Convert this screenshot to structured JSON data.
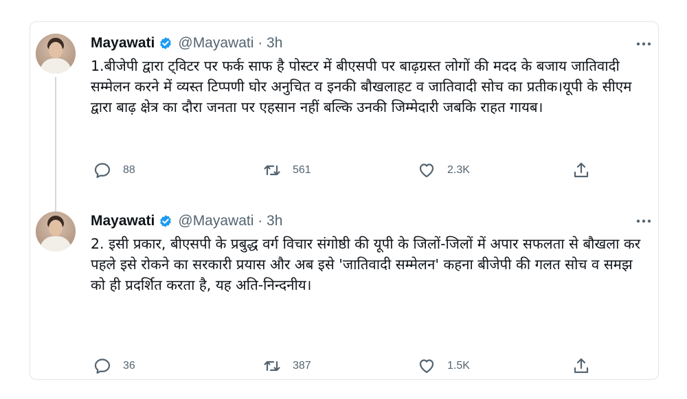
{
  "tweets": [
    {
      "name": "Mayawati",
      "handle": "@Mayawati · 3h",
      "text": "1.बीजेपी द्वारा ट्विटर पर फर्क साफ है पोस्टर में बीएसपी पर बाढ़ग्रस्त लोगों की मदद के बजाय जातिवादी सम्मेलन करने में व्यस्त टिप्पणी घोर अनुचित व इनकी बौखलाहट व जातिवादी सोच का प्रतीक।यूपी के सीएम द्वारा बाढ़ क्षेत्र का दौरा जनता पर एहसान नहीं बल्कि उनकी जिम्मेदारी जबकि राहत गायब।",
      "reply_count": "88",
      "retweet_count": "561",
      "like_count": "2.3K"
    },
    {
      "name": "Mayawati",
      "handle": "@Mayawati · 3h",
      "text": "2. इसी प्रकार, बीएसपी के प्रबुद्ध वर्ग विचार संगोष्ठी की यूपी के जिलों-जिलों में अपार सफलता से बौखला कर पहले इसे रोकने का सरकारी प्रयास और अब इसे 'जातिवादी सम्मेलन' कहना बीजेपी की गलत सोच व समझ को ही प्रदर्शित करता है, यह अति-निन्दनीय।",
      "reply_count": "36",
      "retweet_count": "387",
      "like_count": "1.5K"
    }
  ],
  "icons": {
    "verified": "verified-badge-icon",
    "more": "more-options-icon",
    "reply": "reply-icon",
    "retweet": "retweet-icon",
    "like": "like-icon",
    "share": "share-icon"
  },
  "colors": {
    "verified_blue": "#1d9bf0",
    "text_primary": "#0f1419",
    "text_secondary": "#536471",
    "thread_line": "#cfd9de"
  }
}
